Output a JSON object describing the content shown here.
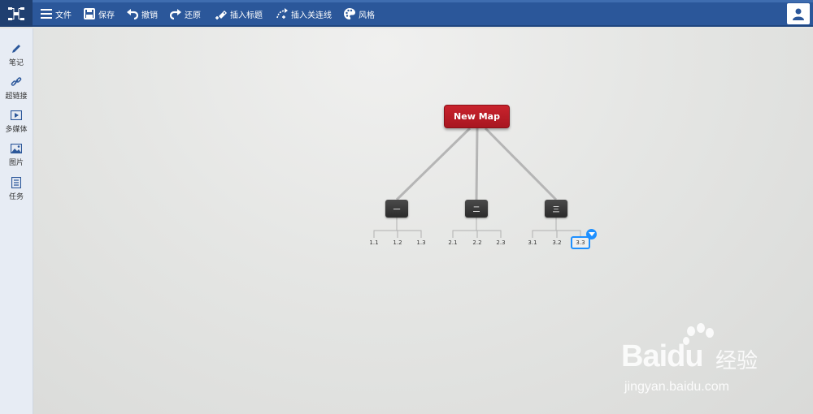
{
  "toolbar": {
    "items": [
      {
        "label": "文件",
        "icon": "menu-icon"
      },
      {
        "label": "保存",
        "icon": "save-icon"
      },
      {
        "label": "撤销",
        "icon": "undo-icon"
      },
      {
        "label": "还原",
        "icon": "redo-icon"
      },
      {
        "label": "插入标题",
        "icon": "insert-topic-icon"
      },
      {
        "label": "插入关连线",
        "icon": "insert-relation-icon"
      },
      {
        "label": "风格",
        "icon": "palette-icon"
      }
    ],
    "logo_icon": "mindmap-logo-icon",
    "user_icon": "user-icon"
  },
  "sidebar": {
    "items": [
      {
        "label": "笔记",
        "icon": "pencil-icon"
      },
      {
        "label": "超链接",
        "icon": "link-icon"
      },
      {
        "label": "多媒体",
        "icon": "media-icon"
      },
      {
        "label": "图片",
        "icon": "image-icon"
      },
      {
        "label": "任务",
        "icon": "task-icon"
      }
    ]
  },
  "mindmap": {
    "root": "New Map",
    "branches": [
      {
        "label": "一",
        "children": [
          "1.1",
          "1.2",
          "1.3"
        ]
      },
      {
        "label": "二",
        "children": [
          "2.1",
          "2.2",
          "2.3"
        ]
      },
      {
        "label": "三",
        "children": [
          "3.1",
          "3.2",
          "3.3"
        ]
      }
    ],
    "selected": "3.3"
  },
  "watermark": {
    "brand": "Baidu",
    "brand_cn": "经验",
    "url": "jingyan.baidu.com"
  },
  "colors": {
    "topbar": "#2b579a",
    "root_node": "#c0202b",
    "branch_node": "#333333",
    "selection": "#1e90ff"
  }
}
